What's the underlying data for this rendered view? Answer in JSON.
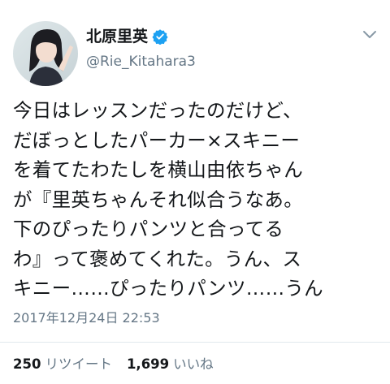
{
  "author": {
    "display_name": "北原里英",
    "handle": "@Rie_Kitahara3",
    "verified_icon": "verified-badge-icon",
    "avatar_icon": "profile-photo"
  },
  "menu_icon": "chevron-down-icon",
  "tweet": {
    "lines": [
      "今日はレッスンだったのだけど、",
      "だぼっとしたパーカー×スキニー",
      "を着てたわたしを横山由依ちゃん",
      "が『里英ちゃんそれ似合うなあ。",
      "下のぴったりパンツと合ってる",
      "わ』って褒めてくれた。うん、ス",
      "キニー……ぴったりパンツ……うん"
    ],
    "timestamp": "2017年12月24日 22:53"
  },
  "stats": {
    "retweets_count": "250",
    "retweets_label": "リツイート",
    "likes_count": "1,699",
    "likes_label": "いいね"
  },
  "colors": {
    "verified": "#1da1f2",
    "secondary_text": "#657786",
    "divider": "#e1e8ed"
  }
}
